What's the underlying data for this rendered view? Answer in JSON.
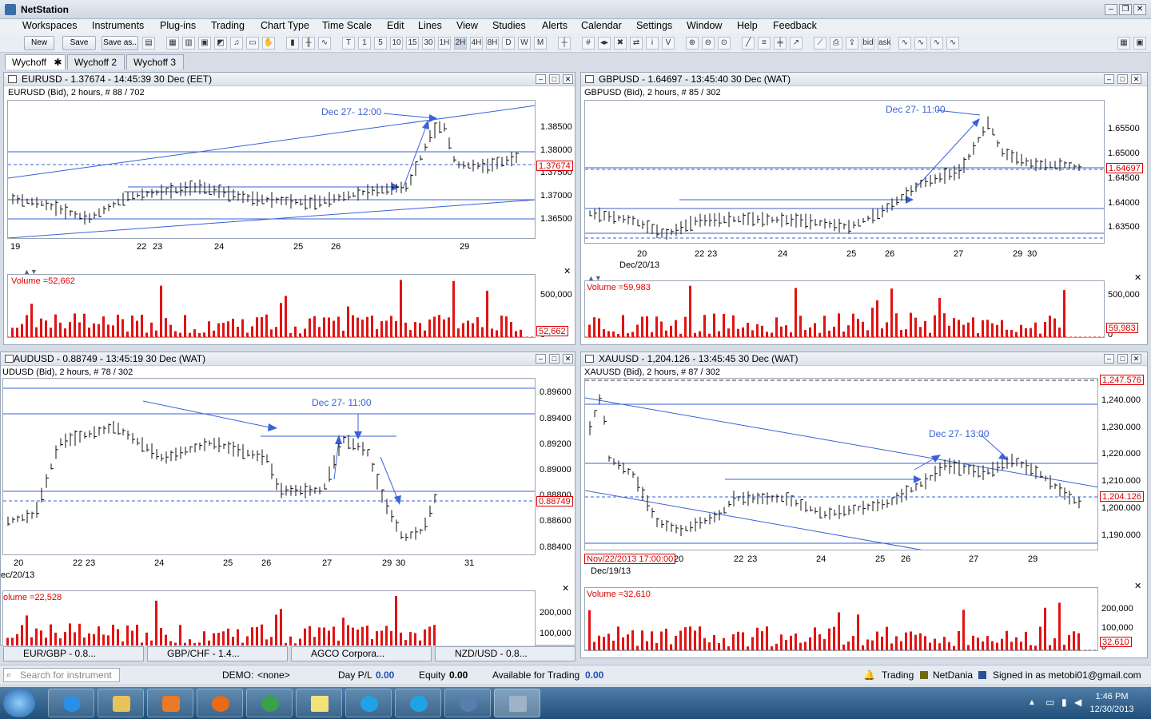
{
  "app": {
    "title": "NetStation"
  },
  "menu": [
    "Workspaces",
    "Instruments",
    "Plug-ins",
    "Trading",
    "Chart Type",
    "Time Scale",
    "Edit",
    "Lines",
    "View",
    "Studies",
    "Alerts",
    "Calendar",
    "Settings",
    "Window",
    "Help",
    "Feedback"
  ],
  "toolbar": {
    "new_label": "New",
    "save_label": "Save",
    "saveas_label": "Save as..",
    "timeframes": [
      "T",
      "1",
      "5",
      "10",
      "15",
      "30",
      "1H",
      "2H",
      "4H",
      "8H",
      "D",
      "W",
      "M"
    ],
    "active_timeframe": "2H",
    "study_labels": [
      "bid",
      "ask"
    ]
  },
  "workspace_tabs": [
    {
      "label": "Wychoff",
      "active": true
    },
    {
      "label": "Wychoff 2",
      "active": false
    },
    {
      "label": "Wychoff 3",
      "active": false
    }
  ],
  "panels": {
    "eurusd": {
      "title": "EURUSD - 1.37674 - 14:45:39  30 Dec (EET)",
      "subtitle": "EURUSD (Bid), 2 hours, # 88 / 702",
      "yticks": [
        "1.38500",
        "1.38000",
        "1.37500",
        "1.37000",
        "1.36500"
      ],
      "price": "1.37674",
      "xticks": [
        "19",
        "22",
        "23",
        "24",
        "25",
        "26",
        "29"
      ],
      "annotation": "Dec 27- 12:00",
      "volume_label": "Volume =52,662",
      "volume_ticks": [
        "500,000",
        "0"
      ],
      "volume_value": "52,662"
    },
    "gbpusd": {
      "title": "GBPUSD - 1.64697 - 13:45:40  30 Dec (WAT)",
      "subtitle": "GBPUSD (Bid), 2 hours, # 85 / 302",
      "yticks": [
        "1.65500",
        "1.65000",
        "1.64500",
        "1.64000",
        "1.63500"
      ],
      "price": "1.64697",
      "xticks": [
        "20",
        "22",
        "23",
        "24",
        "25",
        "26",
        "27",
        "29",
        "30"
      ],
      "date_label": "Dec/20/13",
      "annotation": "Dec 27- 11:00",
      "volume_label": "Volume =59,983",
      "volume_ticks": [
        "500,000",
        "0"
      ],
      "volume_value": "59,983"
    },
    "audusd": {
      "title": "AUDUSD - 0.88749 - 13:45:19  30 Dec (WAT)",
      "subtitle": "UDUSD (Bid), 2 hours, # 78 / 302",
      "yticks": [
        "0.89600",
        "0.89400",
        "0.89200",
        "0.89000",
        "0.88800",
        "0.88600",
        "0.88400"
      ],
      "price": "0.88749",
      "xticks": [
        "20",
        "22",
        "23",
        "24",
        "25",
        "26",
        "27",
        "29",
        "30",
        "31"
      ],
      "date_label": "ec/20/13",
      "annotation": "Dec 27- 11:00",
      "volume_label": "olume =22,528",
      "volume_ticks": [
        "200,000",
        "100,000"
      ]
    },
    "xauusd": {
      "title": "XAUUSD - 1,204.126 - 13:45:45  30 Dec (WAT)",
      "subtitle": "XAUUSD (Bid), 2 hours, # 87 / 302",
      "yticks": [
        "1,240.000",
        "1,230.000",
        "1,220.000",
        "1,210.000",
        "1,200.000",
        "1,190.000"
      ],
      "price": "1,204.126",
      "top_price": "1,247.576",
      "xticks": [
        "20",
        "22",
        "23",
        "24",
        "25",
        "26",
        "27",
        "29"
      ],
      "cursor_date": "Nov/22/2013 17:00:00",
      "date_label": "Dec/19/13",
      "annotation": "Dec 27- 13:00",
      "volume_label": "Volume =32,610",
      "volume_ticks": [
        "200,000",
        "100,000",
        "0"
      ],
      "volume_value": "32,610"
    }
  },
  "mini_windows": [
    "EUR/GBP - 0.8...",
    "GBP/CHF - 1.4...",
    "AGCO Corpora...",
    "NZD/USD - 0.8..."
  ],
  "status": {
    "search_placeholder": "Search for instrument",
    "demo_label": "DEMO:",
    "demo_value": "<none>",
    "daypl_label": "Day P/L",
    "daypl_value": "0.00",
    "equity_label": "Equity",
    "equity_value": "0.00",
    "available_label": "Available for Trading",
    "available_value": "0.00",
    "trading_label": "Trading",
    "netdania_label": "NetDania",
    "signed_in": "Signed in as metobi01@gmail.com"
  },
  "taskbar": {
    "time": "1:46 PM",
    "date": "12/30/2013"
  },
  "colors": {
    "accent": "#3a62d6",
    "volume": "#e01414",
    "price": "#d00000"
  }
}
